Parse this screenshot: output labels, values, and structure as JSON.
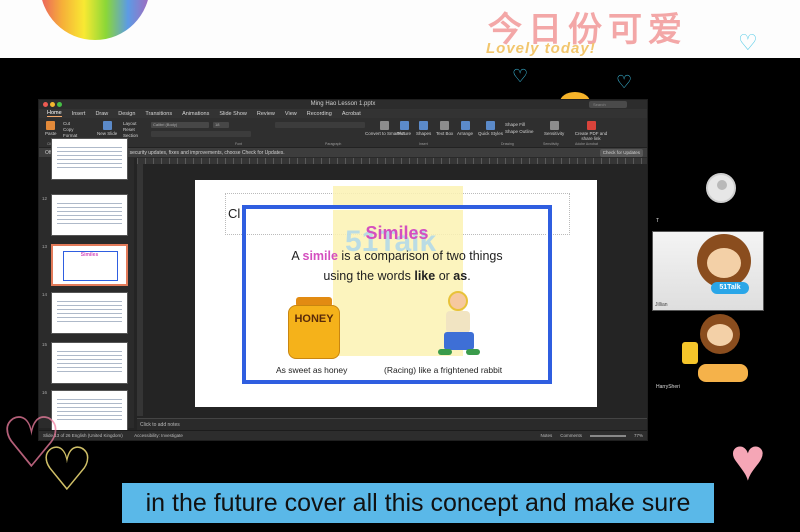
{
  "branding": {
    "title": "今日份可爱",
    "subtitle": "Lovely today!"
  },
  "window": {
    "document_title": "Ming Hao Lesson 1.pptx",
    "search_placeholder": "Search"
  },
  "ribbon_tabs": [
    "Home",
    "Insert",
    "Draw",
    "Design",
    "Transitions",
    "Animations",
    "Slide Show",
    "Review",
    "View",
    "Recording",
    "Acrobat"
  ],
  "ribbon": {
    "paste": "Paste",
    "cut": "Cut",
    "copy": "Copy",
    "format": "Format",
    "new_slide": "New Slide",
    "layout": "Layout",
    "reset": "Reset",
    "section": "Section",
    "font_name": "Calibri (Body)",
    "font_size": "18",
    "convert_smartart": "Convert to SmartArt",
    "picture": "Picture",
    "shapes": "Shapes",
    "text_box": "Text Box",
    "arrange": "Arrange",
    "quick_styles": "Quick Styles",
    "shape_fill": "Shape Fill",
    "shape_outline": "Shape Outline",
    "sensitivity": "Sensitivity",
    "create_pdf": "Create PDF and share link",
    "groups": {
      "clipboard": "Clipboard",
      "slides": "Slides",
      "font": "Font",
      "paragraph": "Paragraph",
      "insert": "Insert",
      "drawing": "Drawing",
      "sensitivity": "Sensitivity",
      "adobe": "Adobe Acrobat"
    }
  },
  "update_bar": {
    "message": "Office Update  To keep up to date with security updates, fixes and improvements, choose Check for Updates.",
    "button": "Check for Updates"
  },
  "slide_numbers": [
    "12",
    "13",
    "14",
    "15",
    "16"
  ],
  "slide": {
    "placeholder_text": "Cl",
    "watermark": "51Talk",
    "title": "Similes",
    "line1_pre": "A ",
    "line1_key": "simile",
    "line1_post": " is a comparison of two things",
    "line2_pre": "using the words ",
    "line2_like": "like",
    "line2_mid": " or ",
    "line2_as": "as",
    "line2_end": ".",
    "honey_label": "HONEY",
    "caption_left": "As sweet as honey",
    "caption_right": "(Racing) like a frightened rabbit"
  },
  "notes": {
    "placeholder": "Click to add notes"
  },
  "status_bar": {
    "left": "Slide 13 of 26   English (United Kingdom)",
    "accessibility": "Accessibility: Investigate",
    "notes": "Notes",
    "comments": "Comments",
    "zoom": "77%"
  },
  "participants": {
    "teacher_label": "Jillian",
    "student_label": "HarrySheri",
    "cam_badge": "51Talk",
    "top_marker": "T"
  },
  "subtitle": "in the future cover all this concept and make sure",
  "colors": {
    "subtitle_bg": "#5ab8e8",
    "simile_pink": "#d44fbf",
    "frame_blue": "#2f5ee0"
  }
}
